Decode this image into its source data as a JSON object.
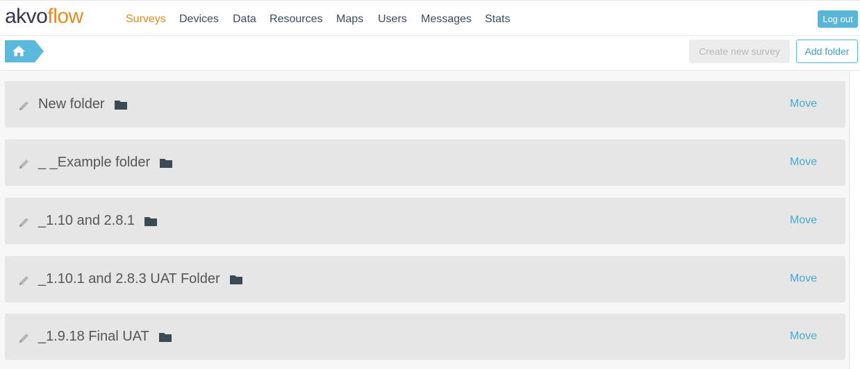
{
  "app": {
    "logo_part1": "akvo",
    "logo_part2": "flow",
    "colors": {
      "accent": "#e08a1e",
      "link": "#4aa8cf",
      "button": "#5ab6d6"
    }
  },
  "nav": {
    "items": [
      {
        "label": "Surveys",
        "active": true
      },
      {
        "label": "Devices"
      },
      {
        "label": "Data"
      },
      {
        "label": "Resources"
      },
      {
        "label": "Maps"
      },
      {
        "label": "Users"
      },
      {
        "label": "Messages"
      },
      {
        "label": "Stats"
      }
    ],
    "logout_label": "Log out"
  },
  "toolbar": {
    "home_icon": "home-icon",
    "create_survey_label": "Create new survey",
    "add_folder_label": "Add folder"
  },
  "folders": [
    {
      "name": "New folder",
      "move_label": "Move"
    },
    {
      "name": "_ _Example folder",
      "move_label": "Move"
    },
    {
      "name": "_1.10 and 2.8.1",
      "move_label": "Move"
    },
    {
      "name": "_1.10.1 and 2.8.3 UAT Folder",
      "move_label": "Move"
    },
    {
      "name": "_1.9.18 Final UAT",
      "move_label": "Move"
    }
  ]
}
